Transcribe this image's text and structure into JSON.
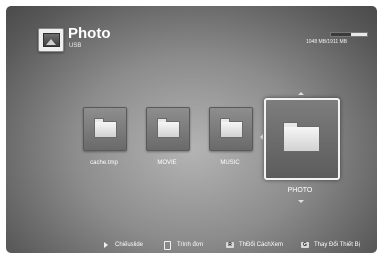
{
  "header": {
    "title": "Photo",
    "subtitle": "USB",
    "storage_text": "1048 MB/1911 MB",
    "storage_used_fraction": 0.55,
    "icon": "photo-icon"
  },
  "folders": [
    {
      "label": "cache.tmp",
      "icon": "folder-icon"
    },
    {
      "label": "MOVIE",
      "icon": "folder-icon"
    },
    {
      "label": "MUSIC",
      "icon": "folder-icon"
    },
    {
      "label": "PHOTO",
      "icon": "folder-icon",
      "selected": true
    }
  ],
  "footer": {
    "slideshow_label": "Chiếuslide",
    "menu_label": "Trình đơn",
    "view_key": "R",
    "view_label": "ThĐổi CáchXem",
    "device_key": "G",
    "device_label": "Thay Đổi Thiết Bị"
  },
  "colors": {
    "background_center": "#b4b4b4",
    "background_edge": "#4a4a4a",
    "selection_border": "#f2f2f2"
  }
}
